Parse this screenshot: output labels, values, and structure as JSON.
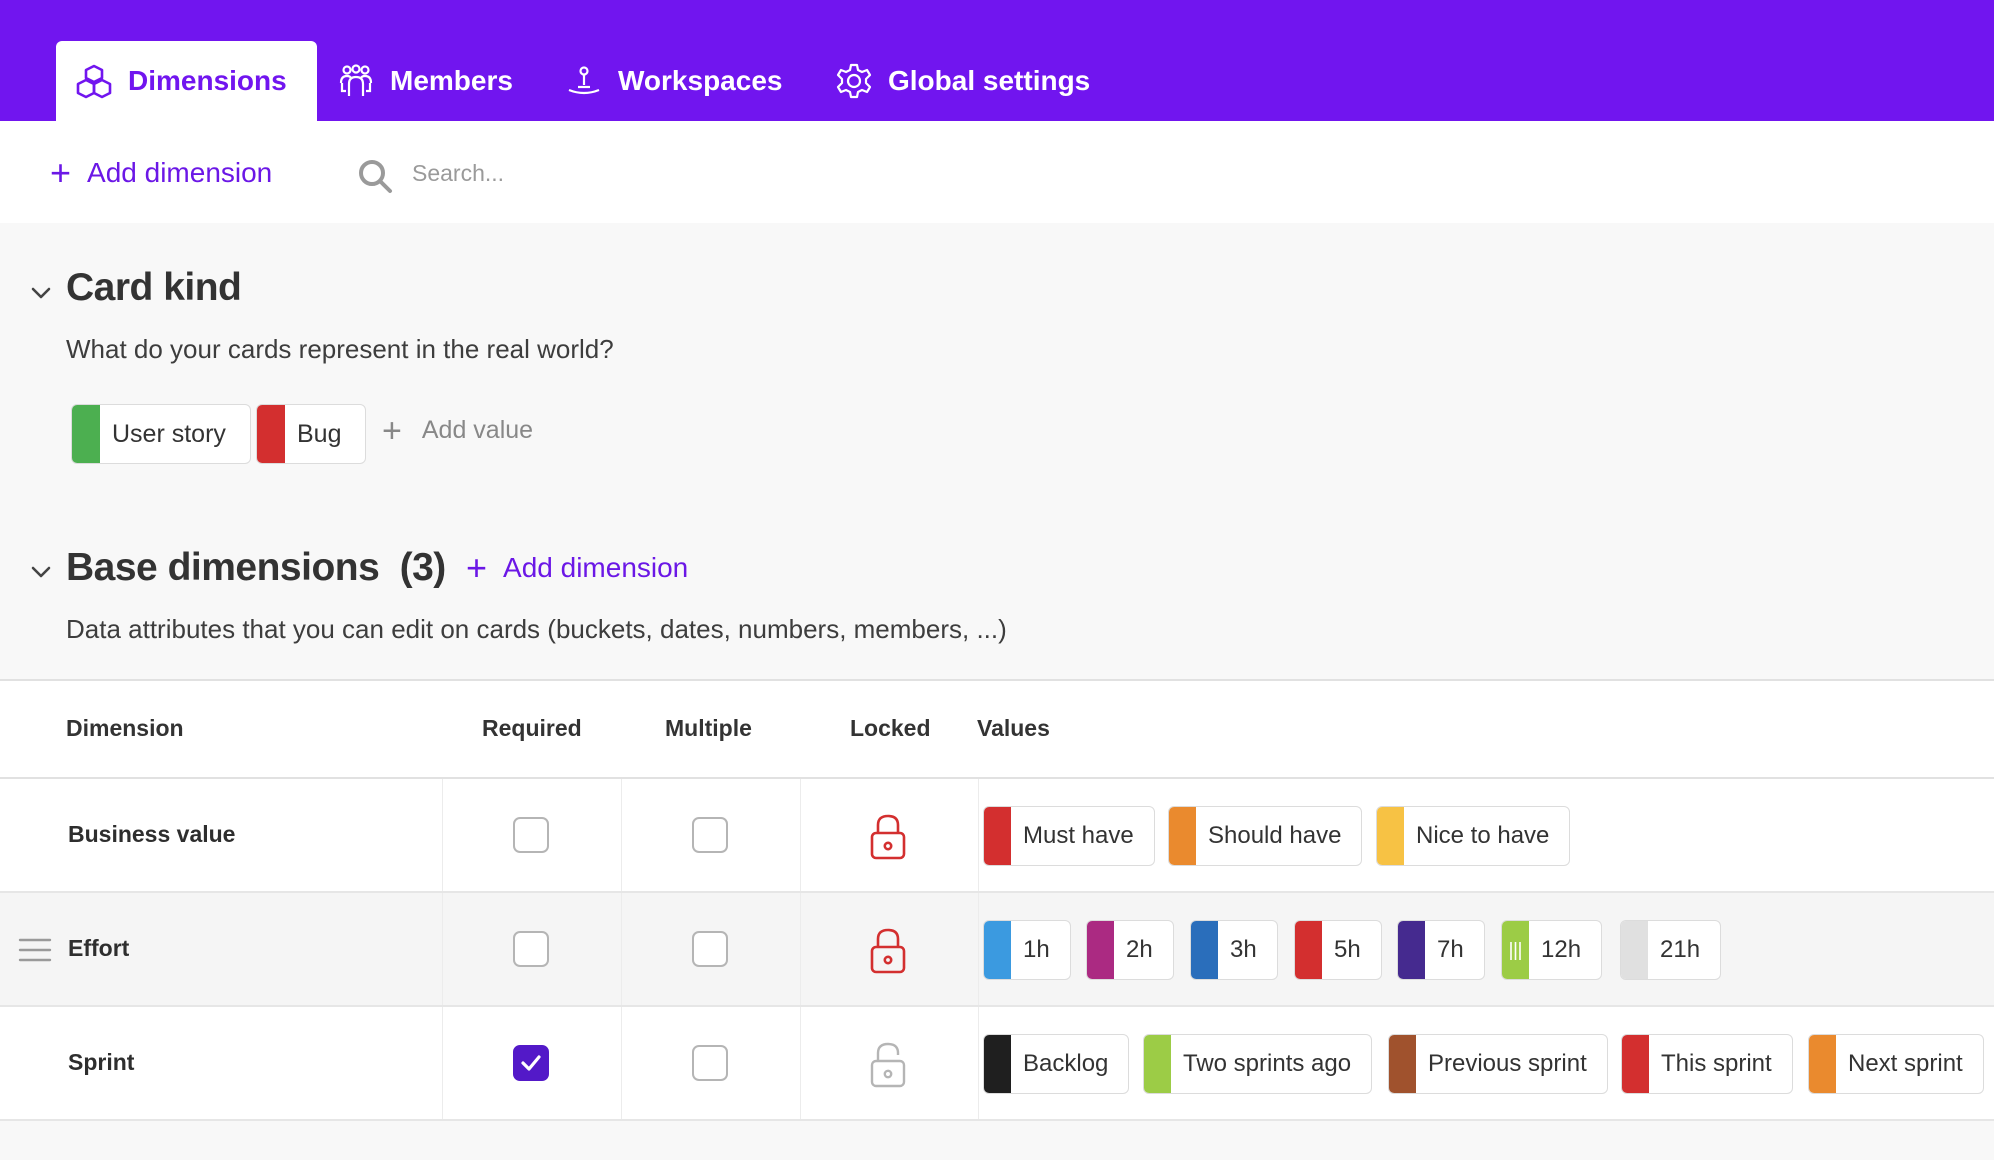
{
  "tabs": [
    {
      "label": "Dimensions",
      "icon": "cubes-icon",
      "active": true
    },
    {
      "label": "Members",
      "icon": "members-icon",
      "active": false
    },
    {
      "label": "Workspaces",
      "icon": "workspaces-icon",
      "active": false
    },
    {
      "label": "Global settings",
      "icon": "gear-icon",
      "active": false
    }
  ],
  "toolbar": {
    "add_dimension_label": "Add dimension",
    "search_placeholder": "Search..."
  },
  "card_kind": {
    "title": "Card kind",
    "description": "What do your cards represent in the real world?",
    "values": [
      {
        "label": "User story",
        "color": "#4caf50"
      },
      {
        "label": "Bug",
        "color": "#d32f2f"
      }
    ],
    "add_value_label": "Add value"
  },
  "base_dimensions": {
    "title": "Base dimensions",
    "count": "(3)",
    "add_dimension_label": "Add dimension",
    "description": "Data attributes that you can edit on cards (buckets, dates, numbers, members, ...)",
    "columns": {
      "dimension": "Dimension",
      "required": "Required",
      "multiple": "Multiple",
      "locked": "Locked",
      "values": "Values"
    },
    "rows": [
      {
        "name": "Business value",
        "required": false,
        "multiple": false,
        "locked": true,
        "values": [
          {
            "label": "Must have",
            "color": "#d32f2f"
          },
          {
            "label": "Should have",
            "color": "#ea8a2e"
          },
          {
            "label": "Nice to have",
            "color": "#f7c244"
          }
        ]
      },
      {
        "name": "Effort",
        "required": false,
        "multiple": false,
        "locked": true,
        "values": [
          {
            "label": "1h",
            "color": "#3b9ae0"
          },
          {
            "label": "2h",
            "color": "#ab2a82"
          },
          {
            "label": "3h",
            "color": "#2a6ebb"
          },
          {
            "label": "5h",
            "color": "#d32f2f"
          },
          {
            "label": "7h",
            "color": "#452a8f"
          },
          {
            "label": "12h",
            "color": "#9ccc46"
          },
          {
            "label": "21h",
            "color": "#e0e0e0"
          }
        ]
      },
      {
        "name": "Sprint",
        "required": true,
        "multiple": false,
        "locked": false,
        "values": [
          {
            "label": "Backlog",
            "color": "#1f1f1f"
          },
          {
            "label": "Two sprints ago",
            "color": "#9ccc46"
          },
          {
            "label": "Previous sprint",
            "color": "#a0522d"
          },
          {
            "label": "This sprint",
            "color": "#d32f2f"
          },
          {
            "label": "Next sprint",
            "color": "#ea8a2e"
          }
        ]
      }
    ]
  }
}
